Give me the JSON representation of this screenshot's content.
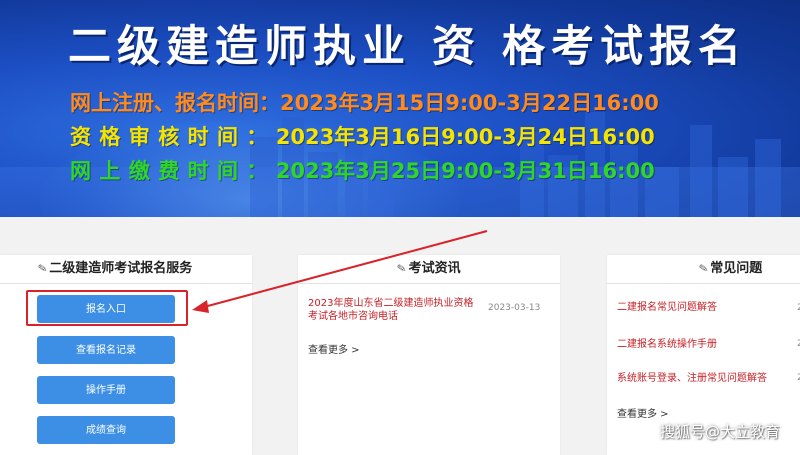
{
  "banner": {
    "title": "二级建造师执业 资 格考试报名",
    "lines": [
      {
        "label": "网上注册、报名时间：",
        "date": "2023年3月15日9:00-3月22日16:00",
        "color": "#ff8a1e"
      },
      {
        "label": "资格审核时间：",
        "date": "2023年3月16日9:00-3月24日16:00",
        "color": "#f5e400"
      },
      {
        "label": "网上缴费时间：",
        "date": "2023年3月25日9:00-3月31日16:00",
        "color": "#2fd629"
      }
    ]
  },
  "services": {
    "title": "二级建造师考试报名服务",
    "buttons": [
      "报名入口",
      "查看报名记录",
      "操作手册",
      "成绩查询"
    ]
  },
  "news": {
    "title": "考试资讯",
    "item": "2023年度山东省二级建造师执业资格考试各地市咨询电话",
    "date": "2023-03-13",
    "more": "查看更多 >"
  },
  "faq": {
    "title": "常见问题",
    "items": [
      "二建报名常见问题解答",
      "二建报名系统操作手册",
      "系统账号登录、注册常见问题解答"
    ],
    "nums": [
      "2",
      "2",
      "2"
    ],
    "more": "查看更多 >"
  },
  "watermark": "搜狐号@大立教育",
  "colors": {
    "accent": "#3d8fe6",
    "highlight": "#d9232a",
    "link": "#c62026"
  }
}
